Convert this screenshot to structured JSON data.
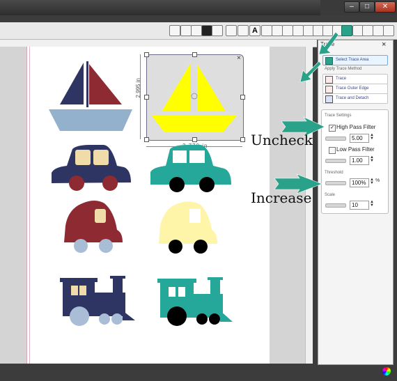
{
  "panel": {
    "title": "Trace",
    "close": "×",
    "select_trace_area": "Select Trace Area",
    "apply_trace_method": "Apply Trace Method",
    "methods": [
      "Trace",
      "Trace Outer Edge",
      "Trace and Detach"
    ],
    "trace_settings": "Trace Settings",
    "high_pass_filter": {
      "label": "High Pass Filter",
      "checked": true,
      "value": "5.00"
    },
    "low_pass_filter": {
      "label": "Low Pass Filter",
      "checked": false,
      "value": "1.00"
    },
    "threshold": {
      "label": "Threshold",
      "value": "100%",
      "unit": "%"
    },
    "scale": {
      "label": "Scale",
      "value": "10"
    }
  },
  "canvas": {
    "selection_width": "3.770 in",
    "selection_height": "2.995 in",
    "selection_close": "×"
  },
  "annotations": {
    "uncheck": "Uncheck",
    "increase": "Increase"
  },
  "colors": {
    "accent_teal": "#2aa189",
    "navy": "#2f3563",
    "maroon": "#8e2a32",
    "yellow": "#ffff00",
    "cream": "#fff5a8",
    "light_blue": "#a9bdd6"
  },
  "icons": [
    "minimize-icon",
    "maximize-icon",
    "close-icon",
    "trace-tool-icon",
    "color-wheel-icon"
  ]
}
